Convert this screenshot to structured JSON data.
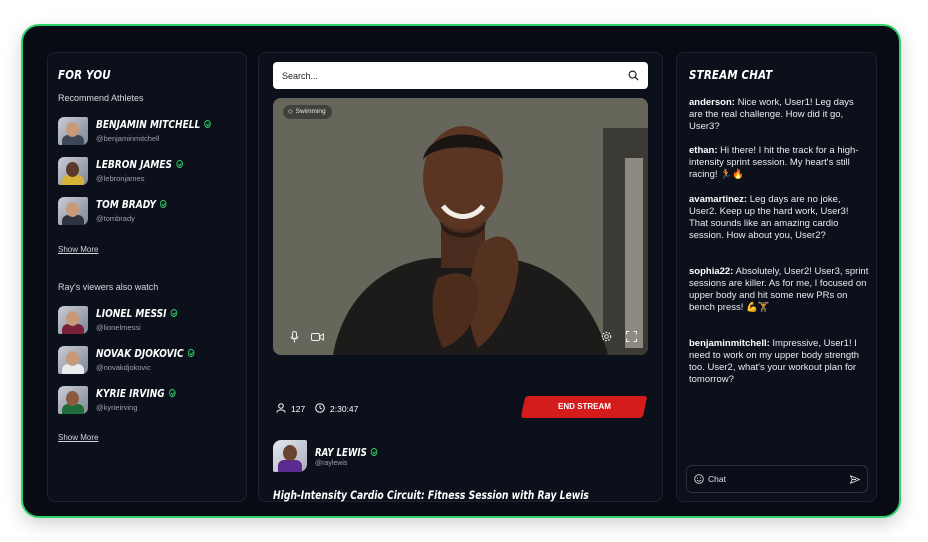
{
  "left": {
    "heading": "FOR YOU",
    "recommend_label": "Recommend Athletes",
    "recommended": [
      {
        "name": "BENJAMIN MITCHELL",
        "handle": "@benjaminmitchell"
      },
      {
        "name": "LEBRON JAMES",
        "handle": "@lebronjames"
      },
      {
        "name": "TOM BRADY",
        "handle": "@tombrady"
      }
    ],
    "show_more_1": "Show More",
    "also_watch_label": "Ray's viewers also watch",
    "also_watch": [
      {
        "name": "LIONEL MESSI",
        "handle": "@lionelmessi"
      },
      {
        "name": "NOVAK DJOKOVIC",
        "handle": "@novakdjokovic"
      },
      {
        "name": "KYRIE IRVING",
        "handle": "@kyrieirving"
      }
    ],
    "show_more_2": "Show More"
  },
  "center": {
    "search_placeholder": "Search...",
    "video_tag": "Swimming",
    "viewers": "127",
    "duration": "2:30:47",
    "end_stream_label": "END STREAM",
    "host_name": "RAY LEWIS",
    "host_handle": "@raylewis",
    "stream_title": "High-Intensity Cardio Circuit: Fitness Session with Ray Lewis"
  },
  "chat": {
    "heading": "STREAM CHAT",
    "messages": [
      {
        "user": "anderson:",
        "text": "Nice work, User1! Leg days are the real challenge. How did it go, User3?"
      },
      {
        "user": "ethan:",
        "text": "Hi there! I hit the track for a high-intensity sprint session. My heart's still racing! 🏃🔥"
      },
      {
        "user": "avamartinez:",
        "text": "Leg days are no joke, User2. Keep up the hard work, User3! That sounds like an amazing cardio session. How about you, User2?"
      },
      {
        "user": "sophia22:",
        "text": "Absolutely, User2! User3, sprint sessions are killer. As for me, I focused on upper body and hit some new PRs on bench press! 💪🏋"
      },
      {
        "user": "benjaminmitchell:",
        "text": "Impressive, User1! I need to work on my upper body strength too. User2, what's your workout plan for tomorrow?"
      }
    ],
    "input_placeholder": "Chat"
  },
  "colors": {
    "accent_green": "#2fd36a",
    "end_red": "#d51c1c",
    "background": "#080b14"
  }
}
